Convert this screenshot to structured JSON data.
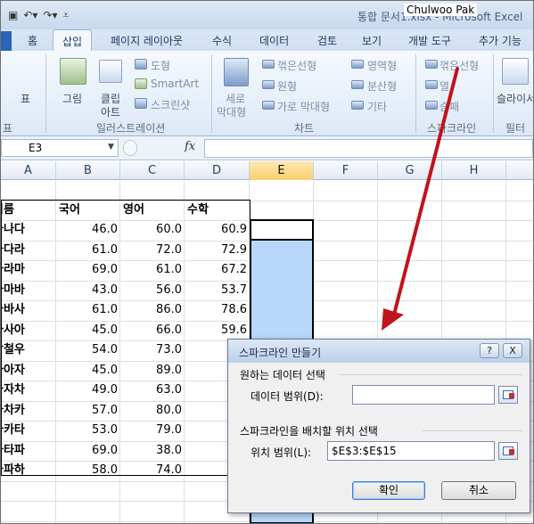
{
  "window": {
    "title": "통합 문서1.xlsx - Microsoft Excel",
    "author_overlay": "Chulwoo Pak",
    "qat_icons": [
      "save-icon",
      "undo-icon",
      "redo-icon",
      "customize-icon"
    ]
  },
  "tabs": [
    {
      "label": "홈"
    },
    {
      "label": "삽입",
      "active": true
    },
    {
      "label": "페이지 레이아웃"
    },
    {
      "label": "수식"
    },
    {
      "label": "데이터"
    },
    {
      "label": "검토"
    },
    {
      "label": "보기"
    },
    {
      "label": "개발 도구"
    },
    {
      "label": "추가 기능"
    }
  ],
  "ribbon": {
    "table": "표",
    "picture": "그림",
    "clipart_l1": "클립",
    "clipart_l2": "아트",
    "shapes": "도형",
    "smartart": "SmartArt",
    "screenshot": "스크린샷",
    "illustrations_group": "일러스트레이션",
    "column_chart_l1": "세로",
    "column_chart_l2": "막대형",
    "line_chart": "꺾은선형",
    "pie_chart": "원형",
    "bar_chart": "가로 막대형",
    "area_chart": "영역형",
    "scatter_chart": "분산형",
    "other_charts": "기타",
    "charts_group": "차트",
    "spark_line": "꺾은선형",
    "spark_column": "열",
    "spark_winloss": "승패",
    "sparklines_group": "스파크라인",
    "slicer": "슬라이서",
    "filter_group": "필터",
    "partial_group_left": "표"
  },
  "formula_bar": {
    "name_box": "E3",
    "fx": "fx",
    "formula": ""
  },
  "columns": [
    "A",
    "B",
    "C",
    "D",
    "E",
    "F",
    "G",
    "H"
  ],
  "selected_column": "E",
  "sheet": {
    "headers": [
      "이름",
      "국어",
      "영어",
      "수학"
    ],
    "rows": [
      {
        "name": "가나다",
        "kor": "46.0",
        "eng": "60.0",
        "math": "60.9"
      },
      {
        "name": "나다라",
        "kor": "61.0",
        "eng": "72.0",
        "math": "72.9"
      },
      {
        "name": "다라마",
        "kor": "69.0",
        "eng": "61.0",
        "math": "67.2"
      },
      {
        "name": "라마바",
        "kor": "43.0",
        "eng": "56.0",
        "math": "53.7"
      },
      {
        "name": "마바사",
        "kor": "61.0",
        "eng": "86.0",
        "math": "78.6"
      },
      {
        "name": "바사아",
        "kor": "45.0",
        "eng": "66.0",
        "math": "59.6"
      },
      {
        "name": "박철우",
        "kor": "54.0",
        "eng": "73.0",
        "math": "7"
      },
      {
        "name": "사아자",
        "kor": "45.0",
        "eng": "89.0",
        "math": "7"
      },
      {
        "name": "아자차",
        "kor": "49.0",
        "eng": "63.0",
        "math": "6"
      },
      {
        "name": "자차카",
        "kor": "57.0",
        "eng": "80.0",
        "math": "7"
      },
      {
        "name": "차카타",
        "kor": "53.0",
        "eng": "79.0",
        "math": "3"
      },
      {
        "name": "카타파",
        "kor": "69.0",
        "eng": "38.0",
        "math": "7"
      },
      {
        "name": "타파하",
        "kor": "58.0",
        "eng": "74.0",
        "math": "4"
      }
    ]
  },
  "dialog": {
    "title": "스파크라인 만들기",
    "help": "?",
    "close": "X",
    "data_section": "원하는 데이터 선택",
    "data_range_label": "데이터 범위(D):",
    "data_range_value": "",
    "location_section": "스파크라인을 배치할 위치 선택",
    "location_range_label": "위치 범위(L):",
    "location_range_value": "$E$3:$E$15",
    "ok": "확인",
    "cancel": "취소"
  },
  "annotation": {
    "arrow_color": "#c0141b"
  }
}
